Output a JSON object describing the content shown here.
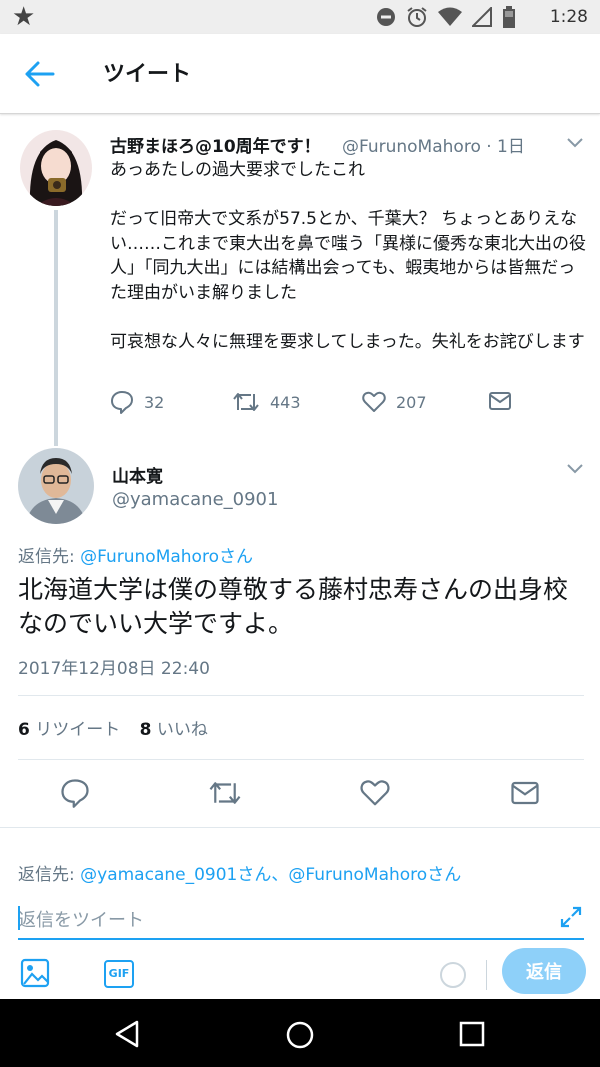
{
  "status_bar": {
    "time": "1:28"
  },
  "header": {
    "title": "ツイート"
  },
  "parent_tweet": {
    "name": "古野まほろ@10周年です！",
    "handle": "@FurunoMahoro · 1日",
    "paragraphs": [
      "あっあたしの過大要求でしたこれ",
      "だって旧帝大で文系が57.5とか、千葉大？ ちょっとありえない……これまで東大出を鼻で嗤う「異様に優秀な東北大出の役人」「同九大出」には結構出会っても、蝦夷地からは皆無だった理由がいま解りました",
      "可哀想な人々に無理を要求してしまった。失礼をお詫びします"
    ],
    "replies": "32",
    "retweets": "443",
    "likes": "207"
  },
  "main_tweet": {
    "name": "山本寛",
    "handle": "@yamacane_0901",
    "reply_to_prefix": "返信先: ",
    "reply_to_user": "@FurunoMahoroさん",
    "text": "北海道大学は僕の尊敬する藤村忠寿さんの出身校なのでいい大学ですよ。",
    "date": "2017年12月08日 22:40",
    "retweet_count": "6",
    "retweet_label": " リツイート",
    "like_count": "8",
    "like_label": " いいね"
  },
  "reply_box": {
    "reply_to_prefix": "返信先: ",
    "reply_to_users": "@yamacane_0901さん、@FurunoMahoroさん",
    "placeholder": "返信をツイート",
    "gif_label": "GIF",
    "send_label": "返信"
  },
  "colors": {
    "accent": "#1da1f2",
    "muted": "#657786",
    "text": "#14171a",
    "send_disabled": "#8ed0f9"
  }
}
